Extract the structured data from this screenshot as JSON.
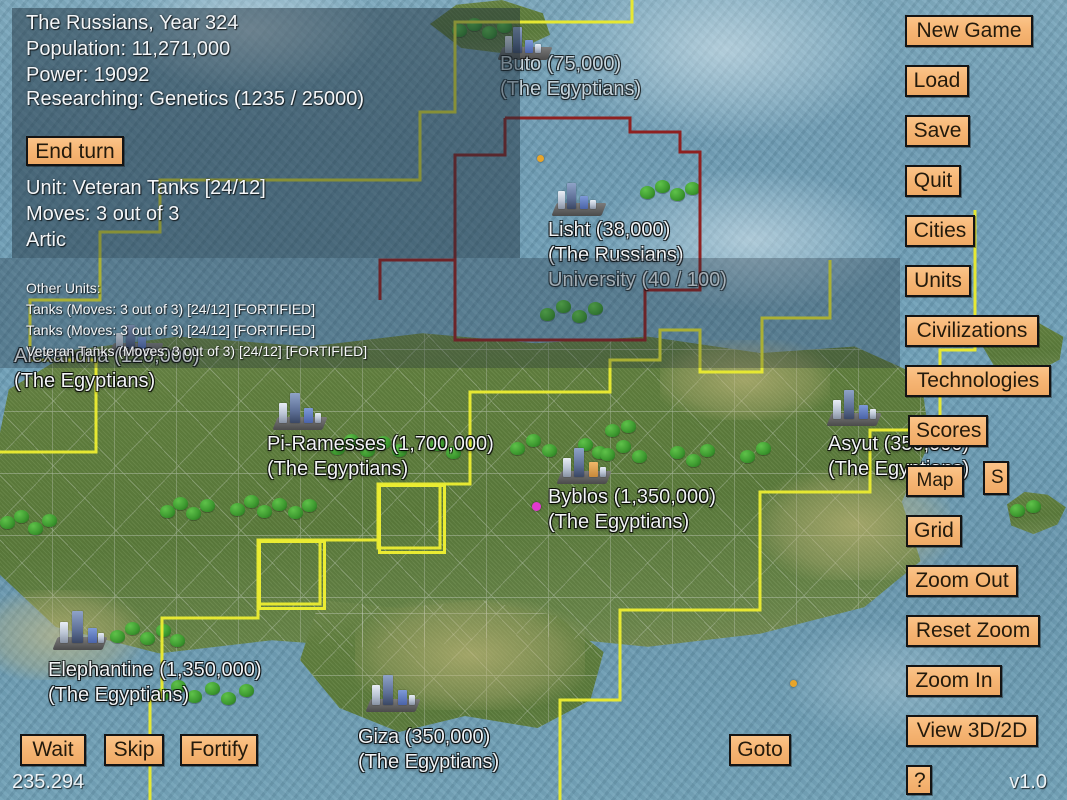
{
  "status_panel": {
    "civ_year": "The Russians, Year 324",
    "population": "Population: 11,271,000",
    "power": "Power: 19092",
    "researching": "Researching: Genetics (1235 / 25000)",
    "end_turn_label": "End turn"
  },
  "unit_panel": {
    "unit": "Unit: Veteran  Tanks [24/12]",
    "moves": "Moves: 3 out of 3",
    "terrain": "Artic"
  },
  "other_units": {
    "heading": "Other Units:",
    "list": [
      "Tanks (Moves: 3 out of 3) [24/12] [FORTIFIED]",
      "Tanks (Moves: 3 out of 3) [24/12] [FORTIFIED]",
      "Veteran Tanks (Moves: 3 out of 3) [24/12] [FORTIFIED]"
    ]
  },
  "unit_actions": [
    {
      "label": "Wait",
      "name": "wait-button"
    },
    {
      "label": "Skip",
      "name": "skip-button"
    },
    {
      "label": "Fortify",
      "name": "fortify-button"
    },
    {
      "label": "Goto",
      "name": "goto-button"
    }
  ],
  "side_menu": [
    {
      "label": "New Game",
      "name": "new-game-button"
    },
    {
      "label": "Load",
      "name": "load-button"
    },
    {
      "label": "Save",
      "name": "save-button"
    },
    {
      "label": "Quit",
      "name": "quit-button"
    },
    {
      "label": "Cities",
      "name": "cities-button"
    },
    {
      "label": "Units",
      "name": "units-button"
    },
    {
      "label": "Civilizations",
      "name": "civilizations-button"
    },
    {
      "label": "Technologies",
      "name": "technologies-button"
    },
    {
      "label": "Scores",
      "name": "scores-button"
    },
    {
      "label": "Map",
      "name": "map-button"
    },
    {
      "label": "S",
      "name": "s-button"
    },
    {
      "label": "Grid",
      "name": "grid-button"
    },
    {
      "label": "Zoom Out",
      "name": "zoom-out-button"
    },
    {
      "label": "Reset Zoom",
      "name": "reset-zoom-button"
    },
    {
      "label": "Zoom In",
      "name": "zoom-in-button"
    },
    {
      "label": "View 3D/2D",
      "name": "view-3d-2d-button"
    },
    {
      "label": "?",
      "name": "help-button"
    }
  ],
  "cities": [
    {
      "name_line": "Buto (75,000)",
      "owner_line": "(The Egyptians)",
      "extra_line": ""
    },
    {
      "name_line": "Lisht (38,000)",
      "owner_line": "(The Russians)",
      "extra_line": "University (40 / 100)"
    },
    {
      "name_line": "Alexandria (120,000)",
      "owner_line": "(The Egyptians)",
      "extra_line": ""
    },
    {
      "name_line": "Pi-Ramesses (1,700,000)",
      "owner_line": "(The Egyptians)",
      "extra_line": ""
    },
    {
      "name_line": "Byblos (1,350,000)",
      "owner_line": "(The Egyptians)",
      "extra_line": ""
    },
    {
      "name_line": "Asyut (350,000)",
      "owner_line": "(The Egyptians)",
      "extra_line": ""
    },
    {
      "name_line": "Elephantine (1,350,000)",
      "owner_line": "(The Egyptians)",
      "extra_line": ""
    },
    {
      "name_line": "Giza (350,000)",
      "owner_line": "(The Egyptians)",
      "extra_line": ""
    }
  ],
  "footer": {
    "coordinates": "235.294",
    "version": "v1.0"
  },
  "colors": {
    "button_face": "#f6b675",
    "button_border": "#141414",
    "egyptian_border": "#e6e832",
    "russian_border": "#8e2020",
    "panel_overlay": "rgba(32,48,60,0.48)",
    "ocean": "#6d9bb3",
    "land": "#62813f"
  }
}
